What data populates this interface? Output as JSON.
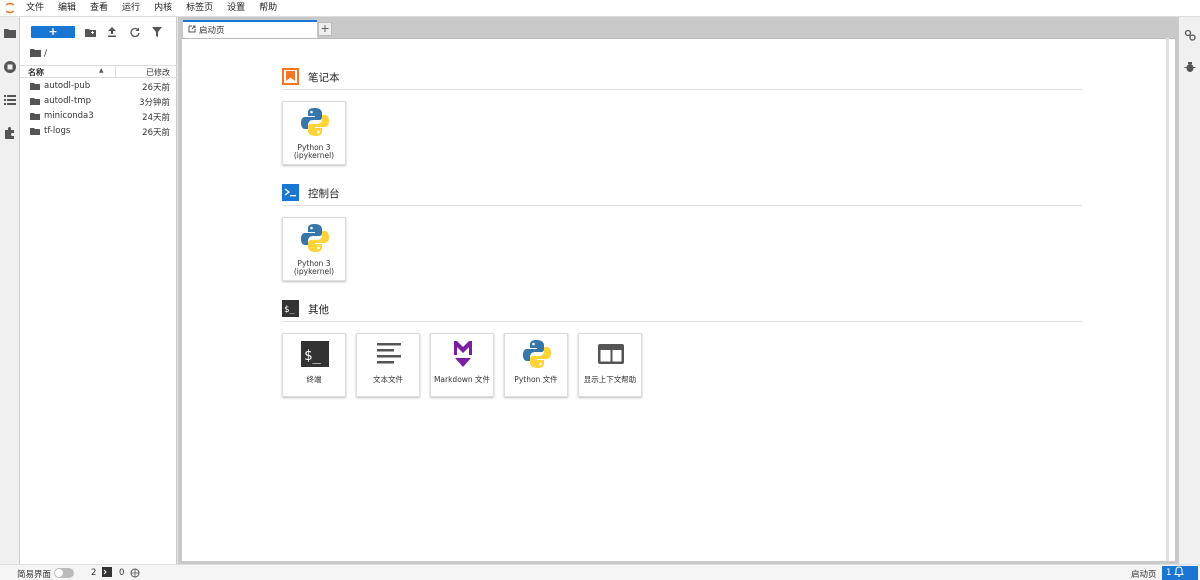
{
  "menubar": {
    "items": [
      "文件",
      "编辑",
      "查看",
      "运行",
      "内核",
      "标签页",
      "设置",
      "帮助"
    ]
  },
  "leftrail": {
    "icons": [
      "folder-icon",
      "running-icon",
      "toc-icon",
      "extension-icon"
    ]
  },
  "filebrowser": {
    "new_label": "+",
    "breadcrumb": "/",
    "header": {
      "name": "名称",
      "modified": "已修改",
      "sort": "▲"
    },
    "rows": [
      {
        "name": "autodl-pub",
        "modified": "26天前"
      },
      {
        "name": "autodl-tmp",
        "modified": "3分钟前"
      },
      {
        "name": "miniconda3",
        "modified": "24天前"
      },
      {
        "name": "tf-logs",
        "modified": "26天前"
      }
    ]
  },
  "tabs": {
    "active_label": "启动页",
    "add_label": "+"
  },
  "launcher": {
    "notebook": {
      "title": "笔记本",
      "cards": [
        {
          "label_line1": "Python 3",
          "label_line2": "(ipykernel)"
        }
      ]
    },
    "console": {
      "title": "控制台",
      "cards": [
        {
          "label_line1": "Python 3",
          "label_line2": "(ipykernel)"
        }
      ]
    },
    "other": {
      "title": "其他",
      "cards": [
        {
          "label": "终端",
          "icon": "terminal-icon"
        },
        {
          "label": "文本文件",
          "icon": "text-file-icon"
        },
        {
          "label": "Markdown 文件",
          "icon": "markdown-icon"
        },
        {
          "label": "Python 文件",
          "icon": "python-icon"
        },
        {
          "label": "显示上下文帮助",
          "icon": "context-help-icon"
        }
      ]
    }
  },
  "statusbar": {
    "simple_mode_label": "简易界面",
    "terminals_count": "2",
    "kernels_count": "0",
    "active_tab": "启动页",
    "notifications": "1"
  },
  "colors": {
    "accent": "#1976d2",
    "notebook_icon": "#f37726",
    "python_blue": "#3776ab",
    "python_yellow": "#ffd43b",
    "markdown": "#7b1fa2"
  }
}
